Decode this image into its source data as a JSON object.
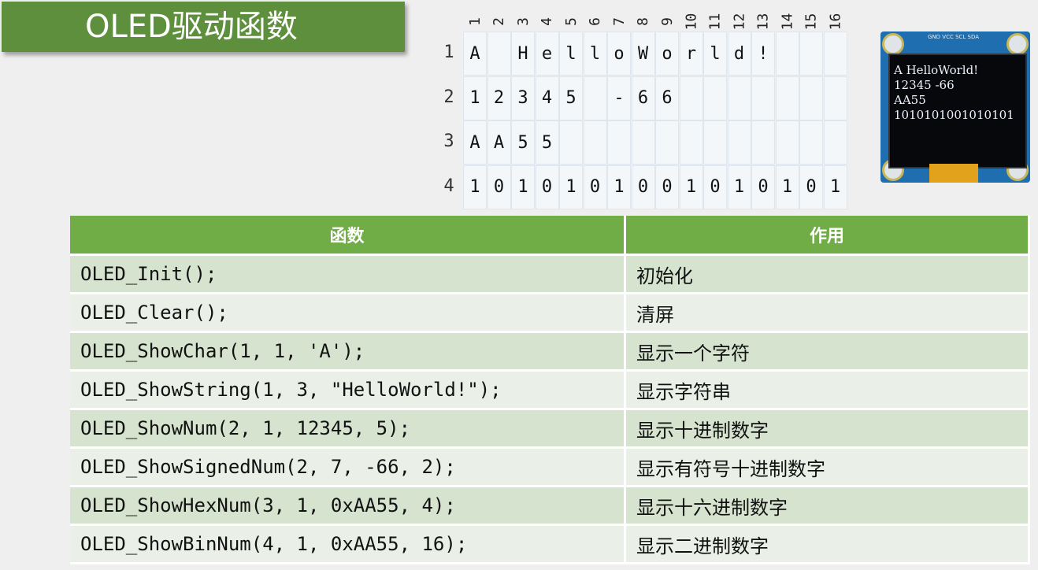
{
  "title": "OLED驱动函数",
  "grid": {
    "columns": [
      "1",
      "2",
      "3",
      "4",
      "5",
      "6",
      "7",
      "8",
      "9",
      "10",
      "11",
      "12",
      "13",
      "14",
      "15",
      "16"
    ],
    "rows": [
      {
        "label": "1",
        "cells": [
          "A",
          "",
          "H",
          "e",
          "l",
          "l",
          "o",
          "W",
          "o",
          "r",
          "l",
          "d",
          "!",
          "",
          "",
          ""
        ]
      },
      {
        "label": "2",
        "cells": [
          "1",
          "2",
          "3",
          "4",
          "5",
          "",
          "-",
          "6",
          "6",
          "",
          "",
          "",
          "",
          "",
          "",
          ""
        ]
      },
      {
        "label": "3",
        "cells": [
          "A",
          "A",
          "5",
          "5",
          "",
          "",
          "",
          "",
          "",
          "",
          "",
          "",
          "",
          "",
          "",
          ""
        ]
      },
      {
        "label": "4",
        "cells": [
          "1",
          "0",
          "1",
          "0",
          "1",
          "0",
          "1",
          "0",
          "0",
          "1",
          "0",
          "1",
          "0",
          "1",
          "0",
          "1"
        ]
      }
    ]
  },
  "oled_display": {
    "pins_label": "GND VCC SCL SDA",
    "lines": [
      "A HelloWorld!",
      "12345 -66",
      "AA55",
      "1010101001010101"
    ]
  },
  "table": {
    "headers": [
      "函数",
      "作用"
    ],
    "rows": [
      {
        "func": "OLED_Init();",
        "desc": "初始化"
      },
      {
        "func": "OLED_Clear();",
        "desc": "清屏"
      },
      {
        "func": "OLED_ShowChar(1, 1, 'A');",
        "desc": "显示一个字符"
      },
      {
        "func": "OLED_ShowString(1, 3, \"HelloWorld!\");",
        "desc": "显示字符串"
      },
      {
        "func": "OLED_ShowNum(2, 1, 12345, 5);",
        "desc": "显示十进制数字"
      },
      {
        "func": "OLED_ShowSignedNum(2, 7, -66, 2);",
        "desc": "显示有符号十进制数字"
      },
      {
        "func": "OLED_ShowHexNum(3, 1, 0xAA55, 4);",
        "desc": "显示十六进制数字"
      },
      {
        "func": "OLED_ShowBinNum(4, 1, 0xAA55, 16);",
        "desc": "显示二进制数字"
      }
    ]
  },
  "colors": {
    "title_bg": "#5d8f3c",
    "header_bg": "#70ad47",
    "row_odd": "#d5e3cf",
    "row_even": "#eaf0e8"
  }
}
